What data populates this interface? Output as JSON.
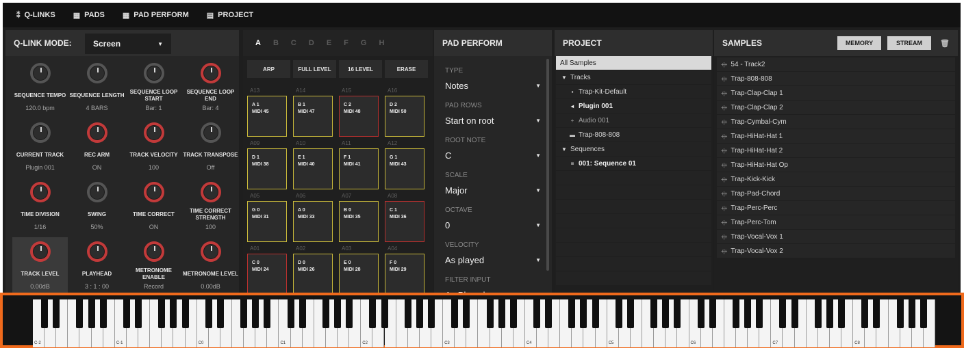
{
  "topbar": {
    "tabs": [
      {
        "icon": "q-links-icon",
        "glyph": "⁑",
        "label": "Q-LINKS"
      },
      {
        "icon": "pads-icon",
        "glyph": "▦",
        "label": "PADS"
      },
      {
        "icon": "pad-perform-icon",
        "glyph": "▦",
        "label": "PAD PERFORM"
      },
      {
        "icon": "project-icon",
        "glyph": "▤",
        "label": "PROJECT"
      }
    ]
  },
  "qlink": {
    "mode_label": "Q-LINK MODE:",
    "mode_value": "Screen",
    "knobs": [
      {
        "name": "SEQUENCE TEMPO",
        "value": "120.0 bpm",
        "accent": false
      },
      {
        "name": "SEQUENCE LENGTH",
        "value": "4 BARS",
        "accent": false
      },
      {
        "name": "SEQUENCE LOOP START",
        "value": "Bar: 1",
        "accent": false
      },
      {
        "name": "SEQUENCE LOOP END",
        "value": "Bar: 4",
        "accent": true
      },
      {
        "name": "CURRENT TRACK",
        "value": "Plugin 001",
        "accent": false
      },
      {
        "name": "REC ARM",
        "value": "ON",
        "accent": true
      },
      {
        "name": "TRACK VELOCITY",
        "value": "100",
        "accent": true
      },
      {
        "name": "TRACK TRANSPOSE",
        "value": "Off",
        "accent": false
      },
      {
        "name": "",
        "value": "",
        "accent": true
      },
      {
        "name": "SWING",
        "value": "50%",
        "accent": false
      },
      {
        "name": "TIME CORRECT",
        "value": "ON",
        "accent": true
      },
      {
        "name": "TIME CORRECT STRENGTH",
        "value": "100",
        "accent": true
      },
      {
        "name": "TRACK LEVEL",
        "value": "0.00dB",
        "accent": true
      },
      {
        "name": "PLAYHEAD",
        "value": "3 : 1 : 00",
        "accent": true
      },
      {
        "name": "METRONOME ENABLE",
        "value": "Record",
        "accent": true
      },
      {
        "name": "METRONOME LEVEL",
        "value": "0.00dB",
        "accent": true
      }
    ],
    "time_division_name": "TIME DIVISION",
    "time_division_value": "1/16"
  },
  "pads": {
    "banks": [
      "A",
      "B",
      "C",
      "D",
      "E",
      "F",
      "G",
      "H"
    ],
    "buttons": [
      "ARP",
      "FULL LEVEL",
      "16 LEVEL",
      "ERASE"
    ],
    "grid": [
      {
        "id": "A13",
        "note": "A 1",
        "midi": "MIDI 45",
        "red": false
      },
      {
        "id": "A14",
        "note": "B 1",
        "midi": "MIDI 47",
        "red": false
      },
      {
        "id": "A15",
        "note": "C 2",
        "midi": "MIDI 48",
        "red": true
      },
      {
        "id": "A16",
        "note": "D 2",
        "midi": "MIDI 50",
        "red": false
      },
      {
        "id": "A09",
        "note": "D 1",
        "midi": "MIDI 38",
        "red": false
      },
      {
        "id": "A10",
        "note": "E 1",
        "midi": "MIDI 40",
        "red": false
      },
      {
        "id": "A11",
        "note": "F 1",
        "midi": "MIDI 41",
        "red": false
      },
      {
        "id": "A12",
        "note": "G 1",
        "midi": "MIDI 43",
        "red": false
      },
      {
        "id": "A05",
        "note": "G 0",
        "midi": "MIDI 31",
        "red": false
      },
      {
        "id": "A06",
        "note": "A 0",
        "midi": "MIDI 33",
        "red": false
      },
      {
        "id": "A07",
        "note": "B 0",
        "midi": "MIDI 35",
        "red": false
      },
      {
        "id": "A08",
        "note": "C 1",
        "midi": "MIDI 36",
        "red": true
      },
      {
        "id": "A01",
        "note": "C 0",
        "midi": "MIDI 24",
        "red": true
      },
      {
        "id": "A02",
        "note": "D 0",
        "midi": "MIDI 26",
        "red": false
      },
      {
        "id": "A03",
        "note": "E 0",
        "midi": "MIDI 28",
        "red": false
      },
      {
        "id": "A04",
        "note": "F 0",
        "midi": "MIDI 29",
        "red": false
      }
    ]
  },
  "pad_perform": {
    "title": "PAD PERFORM",
    "fields": [
      {
        "label": "TYPE",
        "value": "Notes"
      },
      {
        "label": "PAD ROWS",
        "value": "Start on root"
      },
      {
        "label": "ROOT NOTE",
        "value": "C"
      },
      {
        "label": "SCALE",
        "value": "Major"
      },
      {
        "label": "OCTAVE",
        "value": "0"
      },
      {
        "label": "VELOCITY",
        "value": "As played"
      },
      {
        "label": "FILTER INPUT",
        "value": "As Played"
      }
    ]
  },
  "project": {
    "title": "PROJECT",
    "rows": [
      {
        "label": "All Samples",
        "icon": "",
        "indent": 0,
        "style": "hl"
      },
      {
        "label": "Tracks",
        "icon": "▼",
        "indent": 0,
        "style": ""
      },
      {
        "label": "Trap-Kit-Default",
        "icon": "▪",
        "indent": 2,
        "style": ""
      },
      {
        "label": "Plugin 001",
        "icon": "◂",
        "indent": 2,
        "style": "bold"
      },
      {
        "label": "Audio 001",
        "icon": "+",
        "indent": 2,
        "style": "dim"
      },
      {
        "label": "Trap-808-808",
        "icon": "▬",
        "indent": 2,
        "style": ""
      },
      {
        "label": "Sequences",
        "icon": "▼",
        "indent": 0,
        "style": ""
      },
      {
        "label": "001: Sequence 01",
        "icon": "≡",
        "indent": 2,
        "style": "bold"
      },
      {
        "label": "",
        "icon": "",
        "indent": 0,
        "style": ""
      },
      {
        "label": "",
        "icon": "",
        "indent": 0,
        "style": ""
      },
      {
        "label": "",
        "icon": "",
        "indent": 0,
        "style": ""
      },
      {
        "label": "",
        "icon": "",
        "indent": 0,
        "style": ""
      },
      {
        "label": "",
        "icon": "",
        "indent": 0,
        "style": ""
      },
      {
        "label": "",
        "icon": "",
        "indent": 0,
        "style": ""
      },
      {
        "label": "",
        "icon": "",
        "indent": 0,
        "style": ""
      },
      {
        "label": "",
        "icon": "",
        "indent": 0,
        "style": ""
      }
    ]
  },
  "samples": {
    "title": "SAMPLES",
    "memory_label": "MEMORY",
    "stream_label": "STREAM",
    "items": [
      "54 - Track2",
      "Trap-808-808",
      "Trap-Clap-Clap 1",
      "Trap-Clap-Clap 2",
      "Trap-Cymbal-Cym",
      "Trap-HiHat-Hat 1",
      "Trap-HiHat-Hat 2",
      "Trap-HiHat-Hat Op",
      "Trap-Kick-Kick",
      "Trap-Pad-Chord",
      "Trap-Perc-Perc",
      "Trap-Perc-Tom",
      "Trap-Vocal-Vox 1",
      "Trap-Vocal-Vox 2"
    ]
  },
  "keyboard": {
    "octave_labels": [
      "C-2",
      "C-1",
      "C0",
      "C1",
      "C2",
      "C3",
      "C4",
      "C5",
      "C6",
      "C7",
      "C8"
    ]
  }
}
